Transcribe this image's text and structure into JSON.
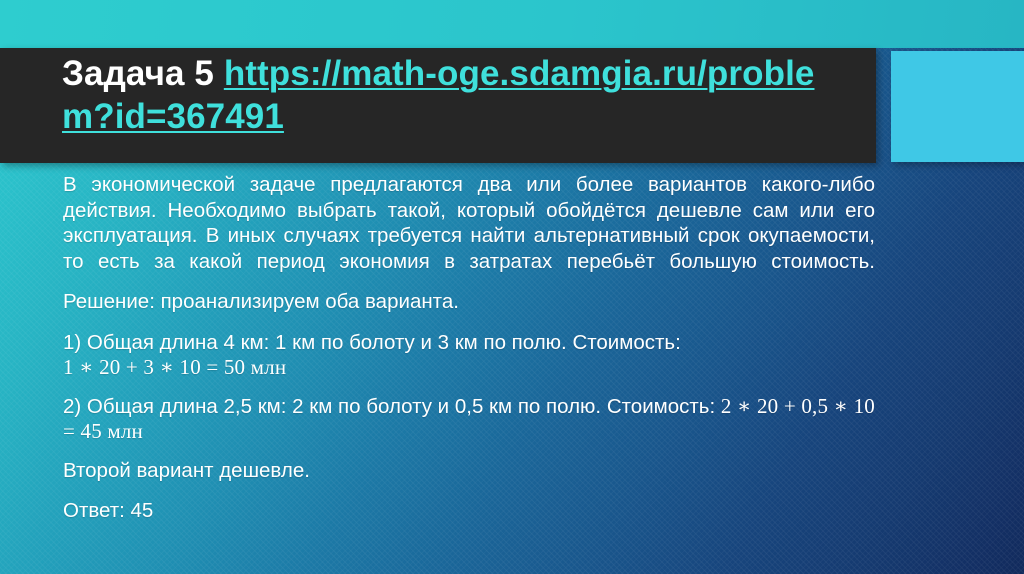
{
  "slide": {
    "title": {
      "lead": "Задача 5 ",
      "link_text": "https://math-oge.sdamgia.ru/problem?id=367491",
      "link_color": "#3FE0DC",
      "lead_color": "#FFFFFF",
      "band_color": "#262626"
    },
    "accent_block": {
      "color": "#3FC8E6"
    },
    "background": {
      "top_left_color": "#2ECBCE",
      "bottom_right_color": "#112A5C",
      "top_strip_color": "#2BC5CC"
    },
    "body": {
      "intro_paragraph": "В экономической задаче предлагаются два или более вариантов какого-либо действия. Необходимо выбрать такой, который обойдётся дешевле сам или его эксплуатация. В иных случаях требуется найти альтернативный срок окупаемости, то есть за какой период экономия в затратах перебьёт большую стоимость.",
      "solution_line": "Решение: проанализируем оба варианта.",
      "option1_text": "1) Общая длина 4 км: 1 км по болоту и 3 км по полю. Стоимость:",
      "option1_math": "1 ∗ 20 + 3 ∗ 10 = 50 млн",
      "option2_text": "2) Общая длина 2,5 км: 2 км по болоту и 0,5 км по полю. Стоимость: ",
      "option2_math": "2 ∗ 20 + 0,5 ∗ 10 = 45 млн",
      "conclusion": "Второй вариант дешевле.",
      "answer": "Ответ: 45"
    }
  }
}
